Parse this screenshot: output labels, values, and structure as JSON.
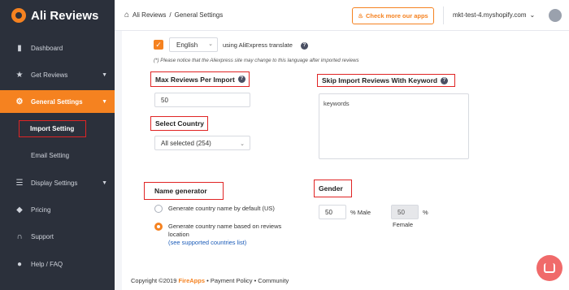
{
  "brand": {
    "name": "Ali Reviews",
    "color": "#f58220"
  },
  "sidebar": {
    "items": [
      {
        "label": "Dashboard",
        "icon": "bar-chart-icon"
      },
      {
        "label": "Get Reviews",
        "icon": "star-icon"
      },
      {
        "label": "General Settings",
        "icon": "gear-icon"
      },
      {
        "label": "Import Setting"
      },
      {
        "label": "Email Setting"
      },
      {
        "label": "Display Settings",
        "icon": "sliders-icon"
      },
      {
        "label": "Pricing",
        "icon": "tag-icon"
      },
      {
        "label": "Support",
        "icon": "headset-icon"
      },
      {
        "label": "Help / FAQ",
        "icon": "help-circle-icon"
      }
    ]
  },
  "header": {
    "breadcrumb_home": "Ali Reviews",
    "breadcrumb_sep": "/",
    "breadcrumb_current": "General Settings",
    "check_apps": "Check more our apps",
    "store": "mkt-test-4.myshopify.com"
  },
  "import": {
    "language": "English",
    "translate_label": "using AliExpress translate",
    "notice": "(*) Please notice that the Aliexpress site may change to this language after imported reviews",
    "max_reviews_label": "Max Reviews Per Import",
    "max_reviews_value": "50",
    "skip_label": "Skip Import Reviews With Keyword",
    "skip_placeholder": "keywords",
    "country_label": "Select Country",
    "country_value": "All selected (254)",
    "name_gen_label": "Name generator",
    "name_opt1": "Generate country name by default (US)",
    "name_opt2": "Generate country name based on reviews location",
    "supported_link": "(see supported countries list)",
    "gender_label": "Gender",
    "male_value": "50",
    "male_label": "% Male",
    "female_value": "50",
    "female_pct": "%",
    "female_label": "Female"
  },
  "footer": {
    "copyright": "Copyright ©2019",
    "brand": "FireApps",
    "links": "• Payment Policy • Community"
  }
}
